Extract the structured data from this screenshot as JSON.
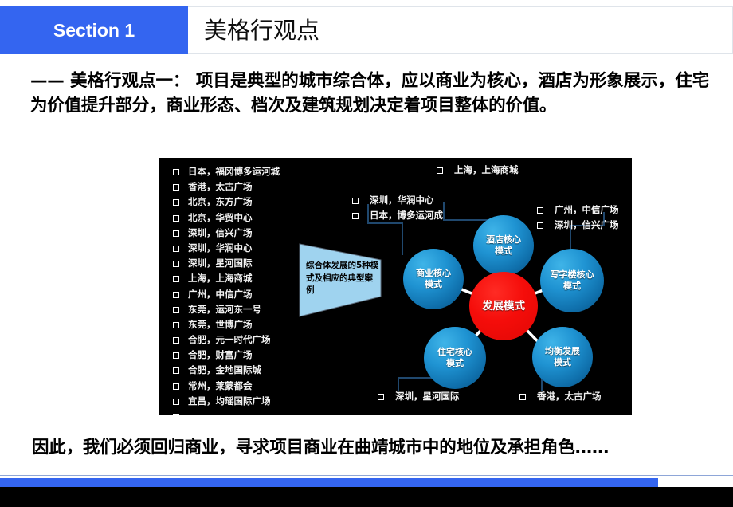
{
  "header": {
    "section_label": "Section 1",
    "title": "美格行观点",
    "accent_color": "#3465f0"
  },
  "intro_paragraph": "—— 美格行观点一： 项目是典型的城市综合体，应以商业为核心，酒店为形象展示，住宅为价值提升部分，商业形态、档次及建筑规划决定着项目整体的价值。",
  "diagram": {
    "background_color": "#000000",
    "case_list": [
      "日本，福冈博多运河城",
      "香港，太古广场",
      "北京，东方广场",
      "北京，华贸中心",
      "深圳，信兴广场",
      "深圳，华润中心",
      "深圳，星河国际",
      "上海，上海商城",
      "广州，中信广场",
      "东莞，运河东一号",
      "东莞，世博广场",
      "合肥，元一时代广场",
      "合肥，财富广场",
      "合肥，金地国际城",
      "常州，莱蒙都会",
      "宜昌，均瑶国际广场",
      "……"
    ],
    "callout": "综合体发展的5种模式及相应的典型案例",
    "center_node": {
      "label": "发展模式",
      "color": "#f50d0a"
    },
    "nodes": [
      {
        "id": "hotel",
        "label_line1": "酒店核心",
        "label_line2": "模式"
      },
      {
        "id": "commercial",
        "label_line1": "商业核心",
        "label_line2": "模式"
      },
      {
        "id": "office",
        "label_line1": "写字楼核心",
        "label_line2": "模式"
      },
      {
        "id": "residential",
        "label_line1": "住宅核心",
        "label_line2": "模式"
      },
      {
        "id": "balanced",
        "label_line1": "均衡发展",
        "label_line2": "模式"
      }
    ],
    "annotations": {
      "hotel": [
        "上海，上海商城"
      ],
      "commercial": [
        "深圳，华润中心",
        "日本，博多运河成"
      ],
      "office": [
        "广州，中信广场",
        "深圳，信兴广场"
      ],
      "residential": [
        "深圳，星河国际"
      ],
      "balanced": [
        "香港，太古广场"
      ]
    },
    "node_color_light": "#3fb4e8",
    "node_color_dark": "#0a4d7c"
  },
  "closing_paragraph": "因此，我们必须回归商业，寻求项目商业在曲靖城市中的地位及承担角色……",
  "footer": {
    "bar_color": "#3465f0",
    "base_color": "#000000"
  }
}
